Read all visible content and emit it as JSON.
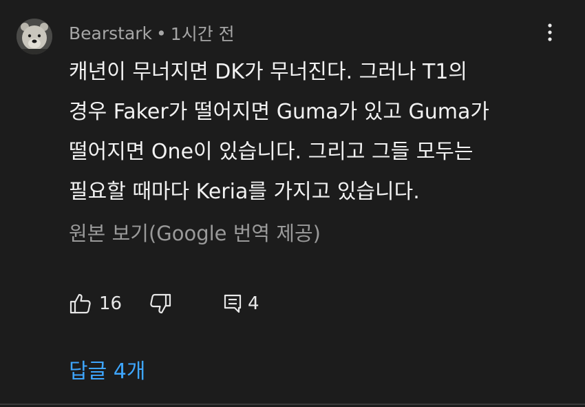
{
  "comment": {
    "author": "Bearstark",
    "separator": "•",
    "timestamp": "1시간 전",
    "avatar_icon": "polar-bear-avatar",
    "text_lines": [
      "캐년이 무너지면 DK가 무너진다. 그러나 T1의",
      "경우 Faker가 떨어지면 Guma가 있고 Guma가",
      "떨어지면 One이 있습니다. 그리고 그들 모두는",
      "필요할 때마다 Keria를 가지고 있습니다."
    ],
    "translate_link": "원본 보기(Google 번역 제공)",
    "likes": "16",
    "reply_count": "4",
    "replies_link": "답글 4개"
  },
  "icons": {
    "more": "more-vertical-icon",
    "like": "thumb-up-icon",
    "dislike": "thumb-down-icon",
    "reply": "comment-icon"
  },
  "colors": {
    "background": "#1c1c1c",
    "text": "#f2f2f2",
    "meta": "#a6a6a6",
    "link": "#3ea6ff"
  }
}
